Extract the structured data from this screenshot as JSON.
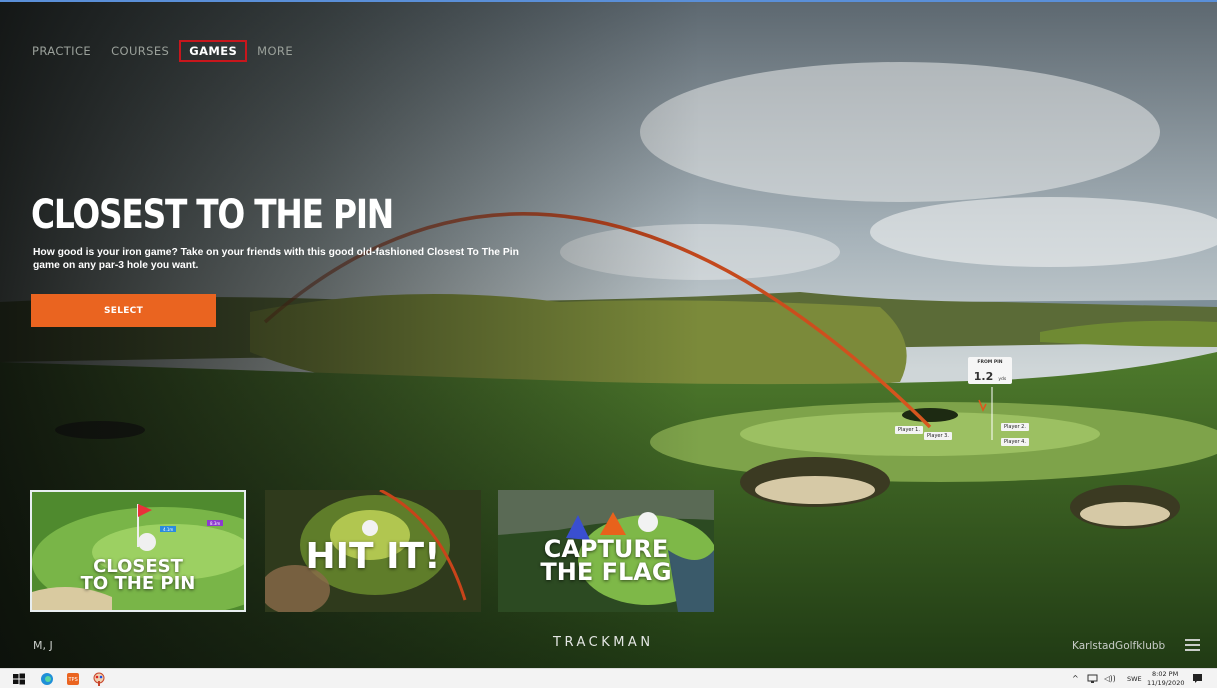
{
  "nav": {
    "items": [
      {
        "label": "PRACTICE"
      },
      {
        "label": "COURSES"
      },
      {
        "label": "GAMES"
      },
      {
        "label": "MORE"
      }
    ],
    "active": "GAMES"
  },
  "hero": {
    "title": "CLOSEST TO THE PIN",
    "description": "How good is your iron game? Take on your friends with this good old-fashioned Closest To The Pin game on any par-3 hole you want.",
    "select_label": "SELECT"
  },
  "overlay": {
    "from_pin_label": "FROM PIN",
    "from_pin_value": "1.2",
    "from_pin_unit": "yds",
    "players": [
      "Player 1.",
      "Player 2.",
      "Player 3.",
      "Player 4."
    ]
  },
  "cards": [
    {
      "label_line1": "CLOSEST",
      "label_line2": "TO THE PIN",
      "badge1": "4.1m",
      "badge2": "8.3m"
    },
    {
      "label_line1": "HIT IT!",
      "label_line2": ""
    },
    {
      "label_line1": "CAPTURE",
      "label_line2": "THE FLAG"
    }
  ],
  "footer": {
    "user_initials": "M, J",
    "brand": "TRACKMAN",
    "club": "KarlstadGolfklubb"
  },
  "taskbar": {
    "language": "SWE",
    "time": "8:02 PM",
    "date": "11/19/2020",
    "app_badge": "TPS"
  },
  "colors": {
    "accent": "#ea6420",
    "active_nav_border": "#c8161c",
    "shot_trace": "#c8441a"
  }
}
